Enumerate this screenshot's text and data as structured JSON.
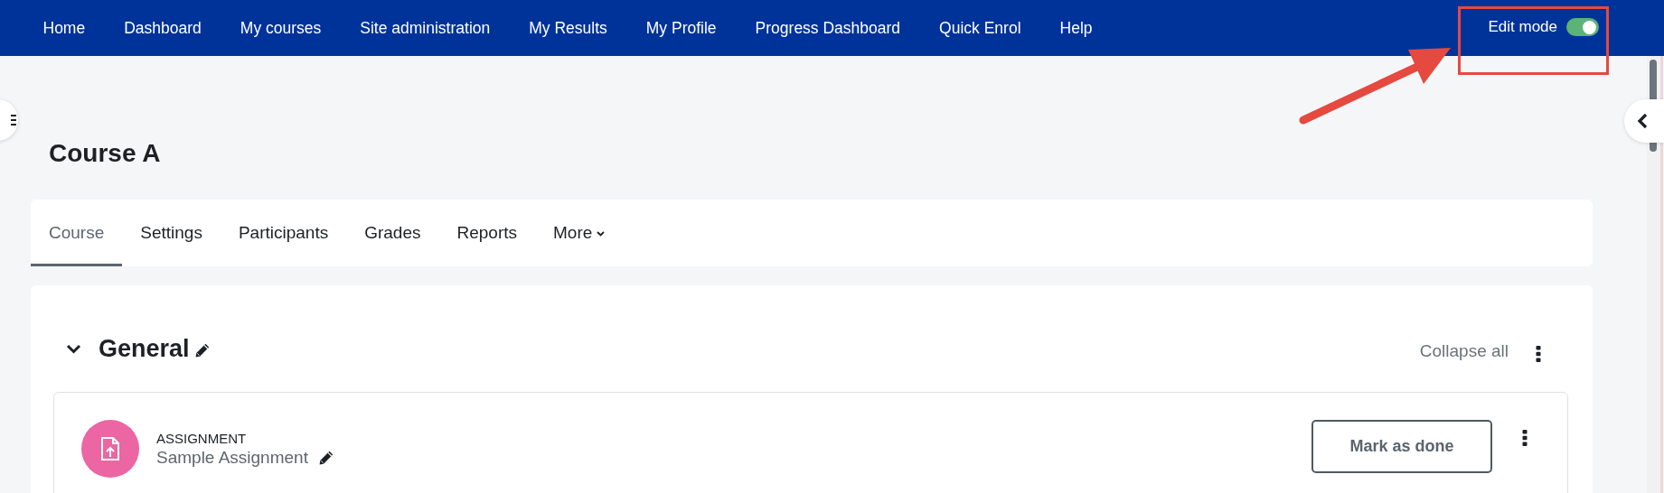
{
  "navbar": {
    "items": [
      {
        "label": "Home"
      },
      {
        "label": "Dashboard"
      },
      {
        "label": "My courses"
      },
      {
        "label": "Site administration"
      },
      {
        "label": "My Results"
      },
      {
        "label": "My Profile"
      },
      {
        "label": "Progress Dashboard"
      },
      {
        "label": "Quick Enrol"
      },
      {
        "label": "Help"
      }
    ],
    "edit_mode": {
      "label": "Edit mode",
      "on": true
    }
  },
  "course": {
    "title": "Course A"
  },
  "tabs": [
    {
      "label": "Course",
      "selected": true,
      "kind": "link"
    },
    {
      "label": "Settings",
      "selected": false,
      "kind": "link"
    },
    {
      "label": "Participants",
      "selected": false,
      "kind": "link"
    },
    {
      "label": "Grades",
      "selected": false,
      "kind": "link"
    },
    {
      "label": "Reports",
      "selected": false,
      "kind": "link"
    },
    {
      "label": "More",
      "selected": false,
      "kind": "dropdown"
    }
  ],
  "section": {
    "title": "General",
    "expanded": true,
    "collapse_all": "Collapse all"
  },
  "activities": [
    {
      "kind": "assignment",
      "type_label": "ASSIGNMENT",
      "name": "Sample Assignment",
      "action": "Mark as done"
    }
  ]
}
